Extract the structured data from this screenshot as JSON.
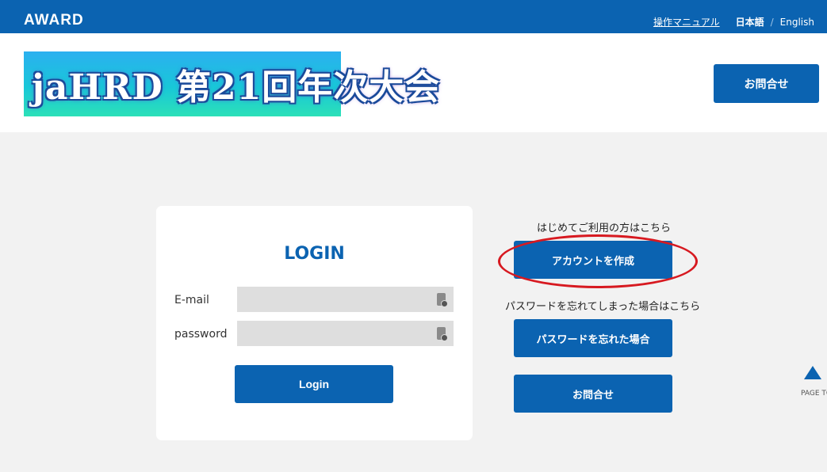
{
  "topbar": {
    "brand": "AWARD",
    "manual_link": "操作マニュアル",
    "lang_ja": "日本語",
    "separator": "/",
    "lang_en": "English"
  },
  "header": {
    "banner_text": "jaHRD 第21回年次大会",
    "contact_button": "お問合せ"
  },
  "login": {
    "title": "LOGIN",
    "email_label": "E-mail",
    "email_value": "",
    "password_label": "password",
    "password_value": "",
    "login_button": "Login"
  },
  "side": {
    "first_time_hint": "はじめてご利用の方はこちら",
    "create_account_button": "アカウントを作成",
    "forgot_hint": "パスワードを忘れてしまった場合はこちら",
    "forgot_button": "パスワードを忘れた場合",
    "contact_button": "お問合せ"
  },
  "page_top": {
    "label": "PAGE TOP",
    "icon": "triangle-up-icon"
  },
  "colors": {
    "primary": "#0b63b1",
    "highlight": "#d71920",
    "background": "#f2f2f2"
  }
}
